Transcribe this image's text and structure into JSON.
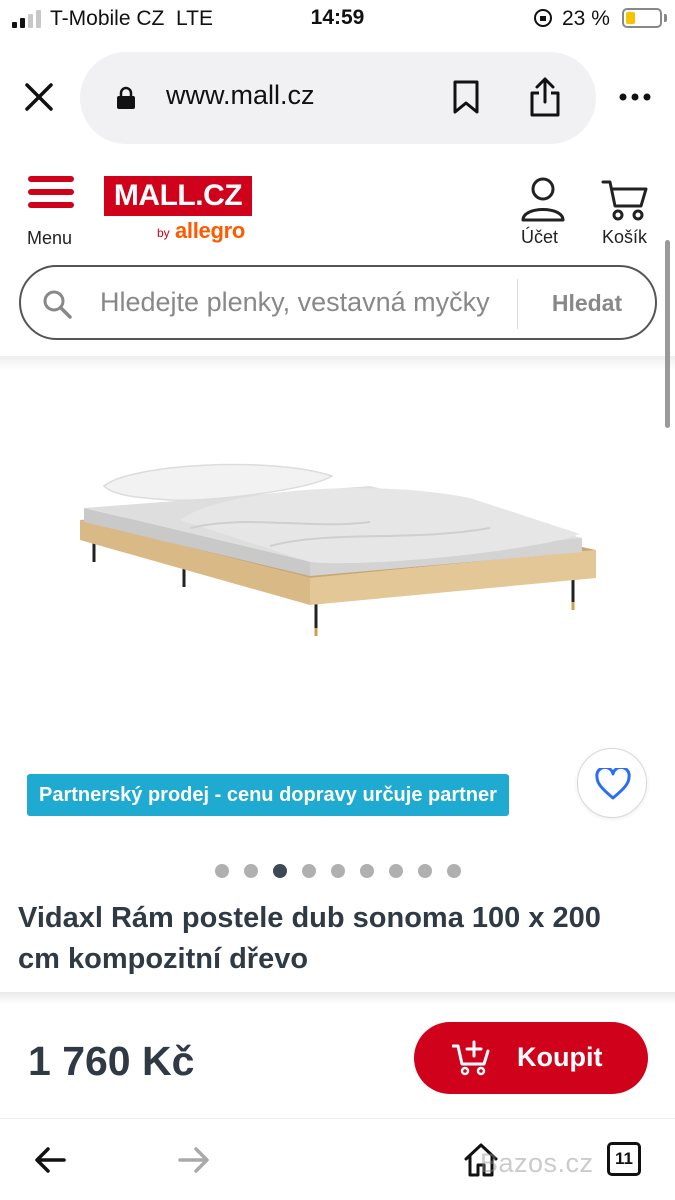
{
  "status_bar": {
    "carrier": "T-Mobile CZ",
    "network": "LTE",
    "time": "14:59",
    "battery": "23 %",
    "signal_bars": 2
  },
  "browser": {
    "url": "www.mall.cz",
    "close_icon": "close-icon",
    "lock_icon": "lock-icon",
    "bookmark_icon": "bookmark-icon",
    "share_icon": "share-icon",
    "more_icon": "more-icon",
    "tabs_count": "11"
  },
  "header": {
    "menu_label": "Menu",
    "logo_text": "MALL.CZ",
    "logo_by": "by",
    "logo_allegro": "allegro",
    "account_label": "Účet",
    "cart_label": "Košík"
  },
  "search": {
    "placeholder": "Hledejte plenky, vestavná myčky",
    "button_label": "Hledat"
  },
  "product": {
    "image_alt": "bed-frame-image",
    "badge": "Partnerský prodej - cenu dopravy určuje partner",
    "title": "Vidaxl Rám postele dub sonoma 100 x 200 cm kompozitní dřevo",
    "price": "1 760 Kč",
    "buy_label": "Koupit",
    "carousel_count": 9,
    "carousel_active": 3
  },
  "watermark": "Bazos.cz",
  "colors": {
    "brand_red": "#d0021b",
    "allegro_orange": "#ff5a00",
    "badge_blue": "#1eaad1",
    "favorite_blue": "#2a6ef5",
    "text_dark": "#2f3a45"
  }
}
